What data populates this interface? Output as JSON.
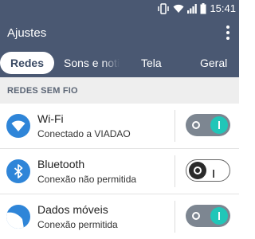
{
  "status_bar": {
    "time": "15:41",
    "icons": [
      "vibrate-icon",
      "wifi-icon",
      "signal-icon",
      "battery-icon"
    ]
  },
  "app_bar": {
    "title": "Ajustes",
    "menu_icon": "more-vert-icon"
  },
  "tabs": [
    {
      "label": "Redes",
      "active": true
    },
    {
      "label": "Sons e notificações",
      "active": false
    },
    {
      "label": "Tela",
      "active": false
    },
    {
      "label": "Geral",
      "active": false
    }
  ],
  "section": {
    "title": "REDES SEM FIO"
  },
  "rows": [
    {
      "title": "Wi-Fi",
      "subtitle": "Conectado a VIADAO",
      "icon": "wifi-icon",
      "enabled": true
    },
    {
      "title": "Bluetooth",
      "subtitle": "Conexão não permitida",
      "icon": "bluetooth-icon",
      "enabled": false
    },
    {
      "title": "Dados móveis",
      "subtitle": "Conexão permitida",
      "icon": "mobile-data-icon",
      "enabled": true
    }
  ],
  "colors": {
    "header": "#4a5872",
    "accent": "#21c6b8",
    "icon_blue": "#2f85d8",
    "section_bg": "#eeeeee"
  }
}
